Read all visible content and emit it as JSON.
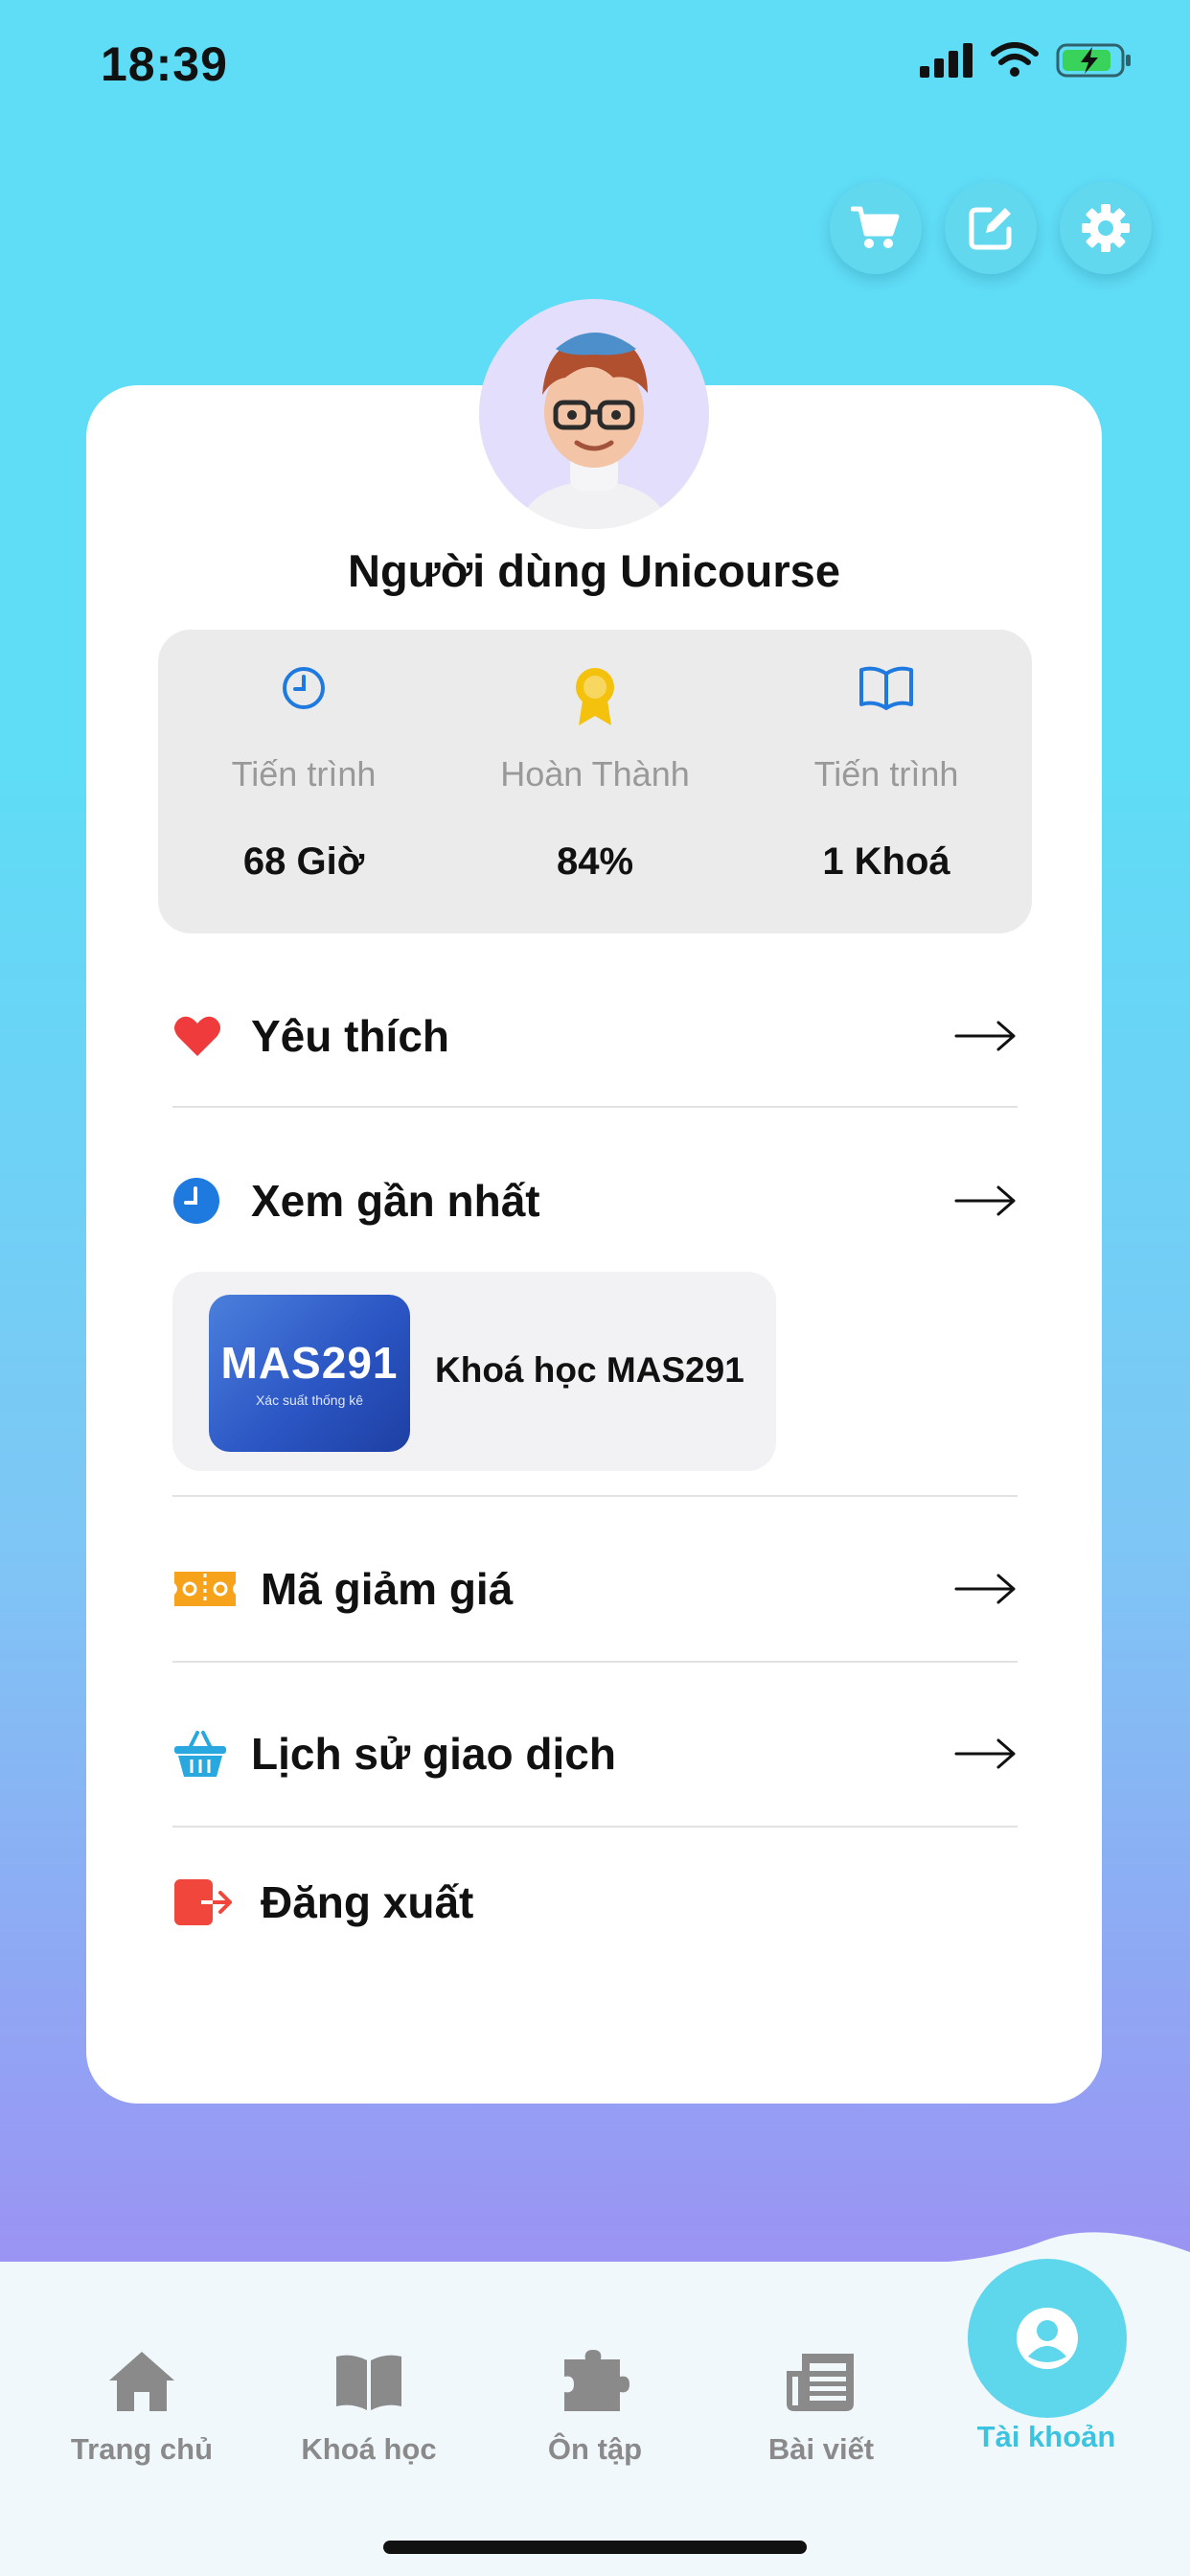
{
  "status_bar": {
    "time": "18:39"
  },
  "profile": {
    "username": "Người dùng Unicourse"
  },
  "stats": [
    {
      "icon": "clock-icon",
      "label": "Tiến trình",
      "value": "68 Giờ"
    },
    {
      "icon": "award-ribbon-icon",
      "label": "Hoàn Thành",
      "value": "84%"
    },
    {
      "icon": "book-open-icon",
      "label": "Tiến trình",
      "value": "1 Khoá"
    }
  ],
  "menu": {
    "favorites": "Yêu thích",
    "recent": "Xem gần nhất",
    "coupons": "Mã giảm giá",
    "history": "Lịch sử giao dịch",
    "logout": "Đăng xuất"
  },
  "recent_course": {
    "thumb_title": "MAS291",
    "thumb_subtitle": "Xác suất thống kê",
    "title": "Khoá học MAS291"
  },
  "tabs": [
    {
      "label": "Trang chủ",
      "icon": "home-icon"
    },
    {
      "label": "Khoá học",
      "icon": "book-icon"
    },
    {
      "label": "Ôn tập",
      "icon": "puzzle-icon"
    },
    {
      "label": "Bài viết",
      "icon": "newspaper-icon"
    },
    {
      "label": "Tài khoản",
      "icon": "user-icon",
      "active": true
    }
  ],
  "colors": {
    "accent": "#5ed6ec",
    "heart": "#ef3b3b",
    "blue_icon": "#1f7ae0",
    "gold": "#f4c20d",
    "coupon": "#f6a21a",
    "logout": "#f0463c"
  }
}
